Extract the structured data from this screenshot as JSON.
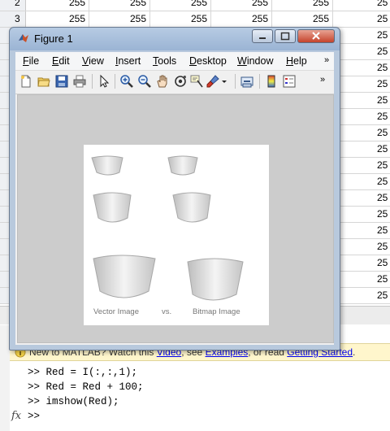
{
  "grid": {
    "rows": [
      {
        "num": "2",
        "values": [
          "255",
          "255",
          "255",
          "255",
          "255",
          "25"
        ]
      },
      {
        "num": "3",
        "values": [
          "255",
          "255",
          "255",
          "255",
          "255",
          "25"
        ]
      },
      {
        "num": "",
        "values": [
          "",
          "",
          "",
          "",
          "",
          "25"
        ]
      },
      {
        "num": "",
        "values": [
          "",
          "",
          "",
          "",
          "",
          "25"
        ]
      },
      {
        "num": "",
        "values": [
          "",
          "",
          "",
          "",
          "",
          "25"
        ]
      },
      {
        "num": "",
        "values": [
          "",
          "",
          "",
          "",
          "",
          "25"
        ]
      },
      {
        "num": "",
        "values": [
          "",
          "",
          "",
          "",
          "",
          "25"
        ]
      },
      {
        "num": "",
        "values": [
          "",
          "",
          "",
          "",
          "",
          "25"
        ]
      },
      {
        "num": "",
        "values": [
          "",
          "",
          "",
          "",
          "",
          "25"
        ]
      },
      {
        "num": "",
        "values": [
          "",
          "",
          "",
          "",
          "",
          "25"
        ]
      },
      {
        "num": "",
        "values": [
          "",
          "",
          "",
          "",
          "",
          "25"
        ]
      },
      {
        "num": "",
        "values": [
          "",
          "",
          "",
          "",
          "",
          "25"
        ]
      },
      {
        "num": "",
        "values": [
          "",
          "",
          "",
          "",
          "",
          "25"
        ]
      },
      {
        "num": "",
        "values": [
          "",
          "",
          "",
          "",
          "",
          "25"
        ]
      },
      {
        "num": "",
        "values": [
          "",
          "",
          "",
          "",
          "",
          "25"
        ]
      },
      {
        "num": "",
        "values": [
          "",
          "",
          "",
          "",
          "",
          "25"
        ]
      },
      {
        "num": "",
        "values": [
          "",
          "",
          "",
          "",
          "",
          "25"
        ]
      },
      {
        "num": "",
        "values": [
          "",
          "",
          "",
          "",
          "",
          "25"
        ]
      },
      {
        "num": "",
        "values": [
          "",
          "",
          "",
          "",
          "",
          "25"
        ]
      }
    ]
  },
  "help": {
    "prefix": "New to MATLAB? Watch this ",
    "video": "Video",
    "mid1": ", see ",
    "examples": "Examples",
    "mid2": ", or read ",
    "started": "Getting Started",
    "suffix": "."
  },
  "command": {
    "lines": [
      ">> Red = I(:,:,1);",
      ">> Red = Red + 100;",
      ">> imshow(Red);",
      ">> "
    ],
    "fx_label": "fx"
  },
  "figure": {
    "title": "Figure 1",
    "menu": [
      {
        "u": "F",
        "rest": "ile"
      },
      {
        "u": "E",
        "rest": "dit"
      },
      {
        "u": "V",
        "rest": "iew"
      },
      {
        "u": "I",
        "rest": "nsert"
      },
      {
        "u": "T",
        "rest": "ools"
      },
      {
        "u": "D",
        "rest": "esktop"
      },
      {
        "u": "W",
        "rest": "indow"
      },
      {
        "u": "H",
        "rest": "elp"
      }
    ],
    "menu_overflow": "»",
    "toolbar_overflow": "»",
    "image_caption_left": "Vector Image",
    "image_caption_mid": "vs.",
    "image_caption_right": "Bitmap Image"
  }
}
